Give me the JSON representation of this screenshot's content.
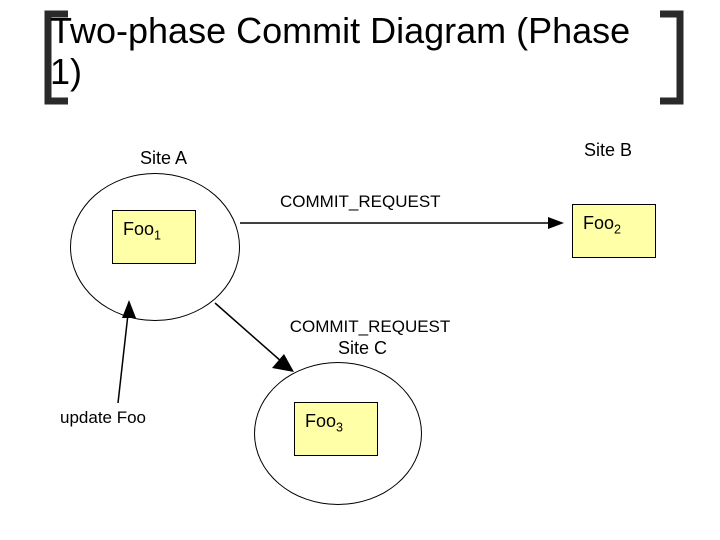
{
  "title": "Two-phase Commit Diagram (Phase 1)",
  "sites": {
    "a": "Site A",
    "b": "Site B",
    "c": "Site C"
  },
  "nodes": {
    "foo1": "Foo",
    "foo1_sub": "1",
    "foo2": "Foo",
    "foo2_sub": "2",
    "foo3": "Foo",
    "foo3_sub": "3"
  },
  "messages": {
    "commit_request_ab": "COMMIT_REQUEST",
    "commit_request_ac": "COMMIT_REQUEST"
  },
  "update_label": "update Foo"
}
